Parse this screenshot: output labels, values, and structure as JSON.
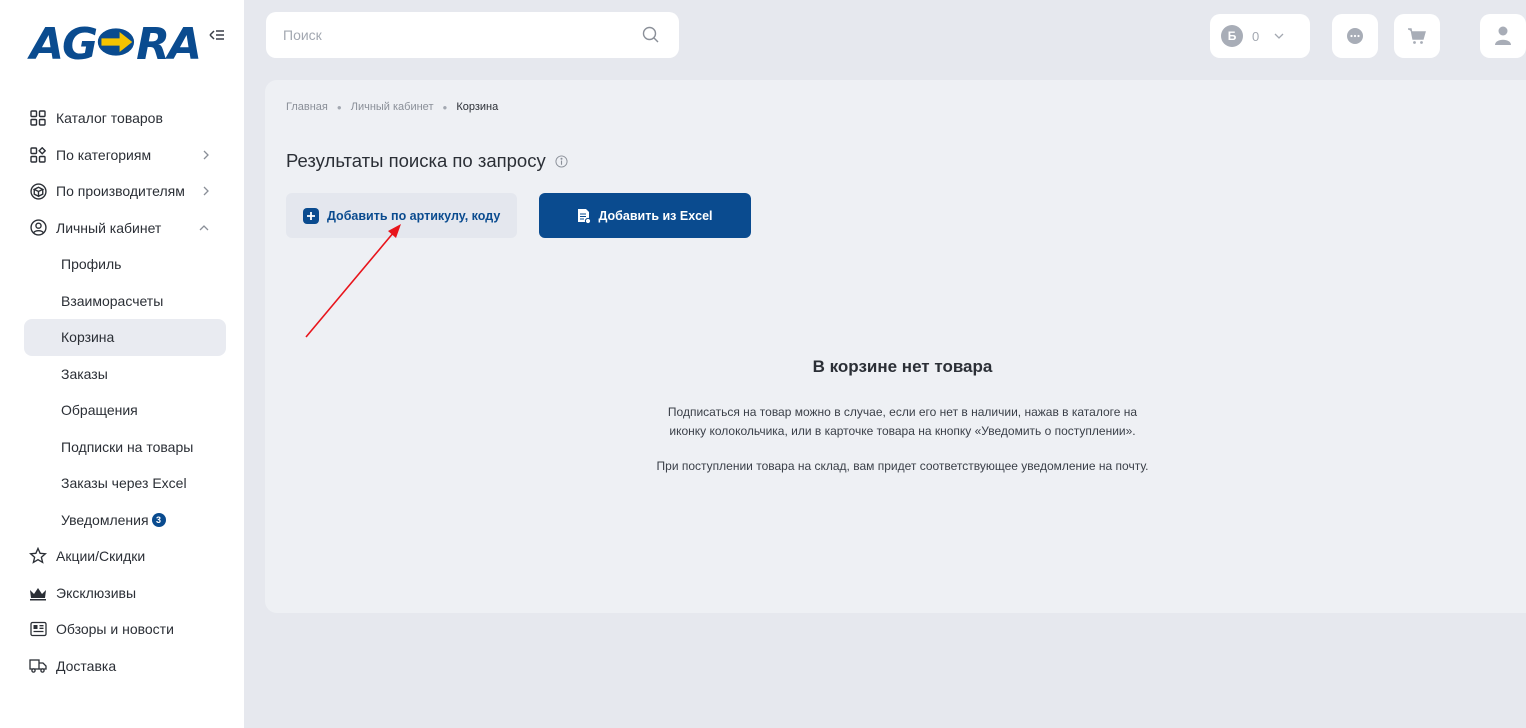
{
  "logo": {
    "text_left": "AG",
    "text_right": "RA",
    "brand_color": "#0a4b8f",
    "accent_color": "#f5c400"
  },
  "sidebar": {
    "collapse_icon": "collapse-menu-icon",
    "items": [
      {
        "label": "Каталог товаров",
        "icon": "grid-icon"
      },
      {
        "label": "По категориям",
        "icon": "categories-icon",
        "chevron": "›"
      },
      {
        "label": "По производителям",
        "icon": "box-icon",
        "chevron": "›"
      },
      {
        "label": "Личный кабинет",
        "icon": "user-circle-icon",
        "chevron": "⌃"
      }
    ],
    "submenu": [
      {
        "label": "Профиль"
      },
      {
        "label": "Взаиморасчеты"
      },
      {
        "label": "Корзина",
        "active": true
      },
      {
        "label": "Заказы"
      },
      {
        "label": "Обращения"
      },
      {
        "label": "Подписки на товары"
      },
      {
        "label": "Заказы через Excel"
      },
      {
        "label": "Уведомления",
        "badge": "3"
      }
    ],
    "bottom_items": [
      {
        "label": "Акции/Скидки",
        "icon": "star-icon"
      },
      {
        "label": "Эксклюзивы",
        "icon": "crown-icon"
      },
      {
        "label": "Обзоры и новости",
        "icon": "news-icon"
      },
      {
        "label": "Доставка",
        "icon": "truck-icon"
      }
    ]
  },
  "header": {
    "search_placeholder": "Поиск",
    "balance_letter": "Б",
    "balance_value": "0"
  },
  "breadcrumb": [
    "Главная",
    "Личный кабинет",
    "Корзина"
  ],
  "page_title": "Результаты поиска по запросу",
  "buttons": {
    "add_by_code": "Добавить по артикулу, коду",
    "add_from_excel": "Добавить из Excel"
  },
  "empty_state": {
    "title": "В корзине нет товара",
    "line1": "Подписаться на товар можно в случае, если его нет в наличии, нажав в каталоге на",
    "line2": "иконку колокольчика, или в карточке товара на кнопку «Уведомить о поступлении».",
    "line3": "При поступлении товара на склад, вам придет соответствующее уведомление на почту."
  },
  "annotation": {
    "type": "red-arrow",
    "color": "#e8141b"
  }
}
